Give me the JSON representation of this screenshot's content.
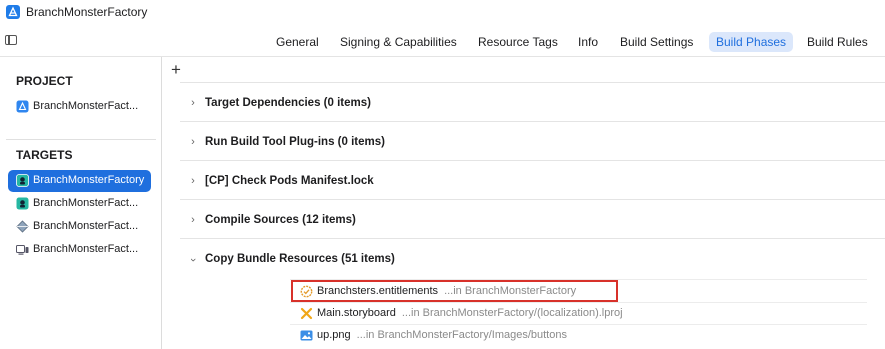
{
  "window": {
    "title": "BranchMonsterFactory"
  },
  "tabs": [
    {
      "label": "General",
      "active": false
    },
    {
      "label": "Signing & Capabilities",
      "active": false
    },
    {
      "label": "Resource Tags",
      "active": false
    },
    {
      "label": "Info",
      "active": false
    },
    {
      "label": "Build Settings",
      "active": false
    },
    {
      "label": "Build Phases",
      "active": true
    },
    {
      "label": "Build Rules",
      "active": false
    }
  ],
  "sidebar": {
    "project_heading": "PROJECT",
    "project_item": {
      "label": "BranchMonsterFact...",
      "icon": "app-blueprint-icon"
    },
    "targets_heading": "TARGETS",
    "targets": [
      {
        "label": "BranchMonsterFactory",
        "icon": "monster-app-icon",
        "selected": true
      },
      {
        "label": "BranchMonsterFact...",
        "icon": "monster-app-icon",
        "selected": false
      },
      {
        "label": "BranchMonsterFact...",
        "icon": "framework-icon",
        "selected": false
      },
      {
        "label": "BranchMonsterFact...",
        "icon": "app-clip-icon",
        "selected": false
      }
    ]
  },
  "main": {
    "add_label": "+",
    "phases": [
      {
        "label": "Target Dependencies (0 items)",
        "expanded": false
      },
      {
        "label": "Run Build Tool Plug-ins (0 items)",
        "expanded": false
      },
      {
        "label": "[CP] Check Pods Manifest.lock",
        "expanded": false
      },
      {
        "label": "Compile Sources (12 items)",
        "expanded": false
      },
      {
        "label": "Copy Bundle Resources (51 items)",
        "expanded": true
      }
    ],
    "resources": [
      {
        "name": "Branchsters.entitlements",
        "location": "...in BranchMonsterFactory",
        "icon": "entitlements-icon",
        "highlighted": true
      },
      {
        "name": "Main.storyboard",
        "location": "...in BranchMonsterFactory/(localization).lproj",
        "icon": "storyboard-icon",
        "highlighted": false
      },
      {
        "name": "up.png",
        "location": "...in BranchMonsterFactory/Images/buttons",
        "icon": "image-file-icon",
        "highlighted": false
      }
    ]
  },
  "colors": {
    "accent": "#1f6fde",
    "active_tab_bg": "#dbe7fb",
    "highlight_border": "#d8312a"
  }
}
